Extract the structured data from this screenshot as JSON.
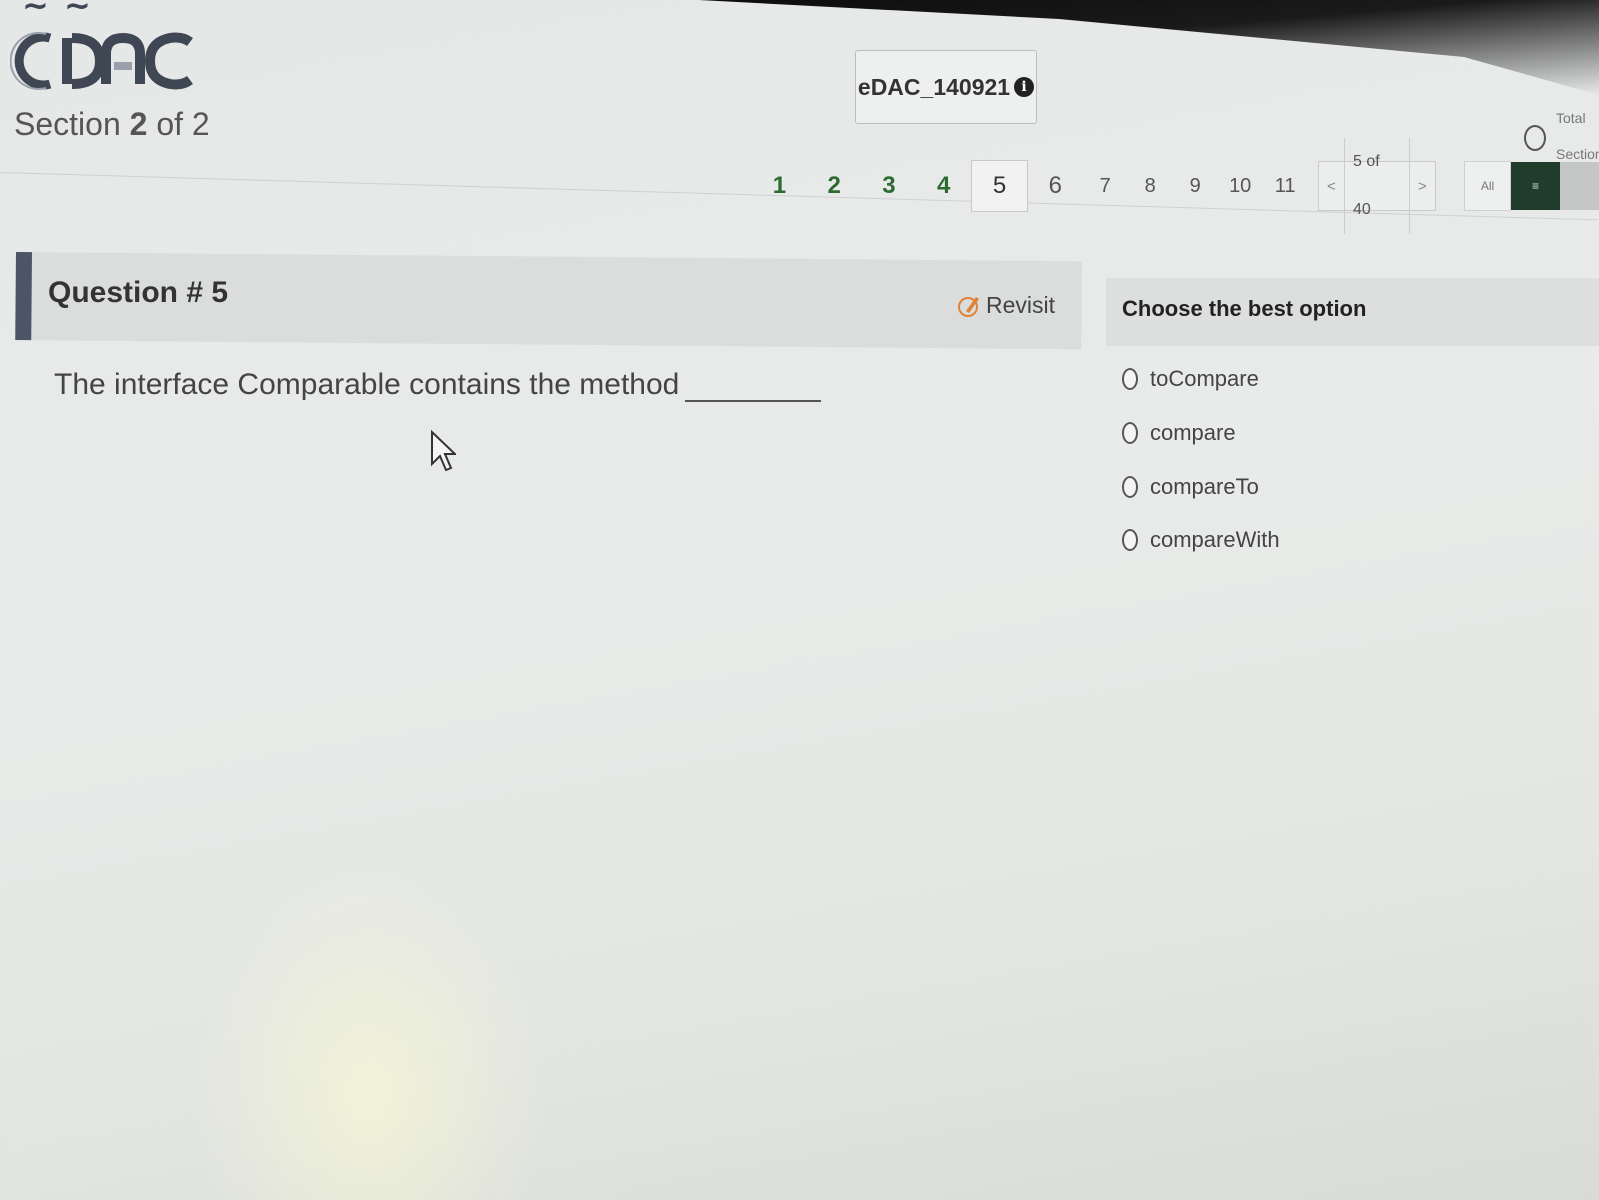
{
  "header": {
    "logo_text": "CDAC",
    "section_label": "Section",
    "section_current": "2",
    "section_of": "of 2",
    "candidate_id": "eDAC_140921",
    "info_icon": "info-icon",
    "timer_line1": "Total",
    "timer_line2": "Section"
  },
  "pager": {
    "questions": [
      "1",
      "2",
      "3",
      "4",
      "5",
      "6",
      "7",
      "8",
      "9",
      "10",
      "11"
    ],
    "answered": [
      "1",
      "2",
      "3",
      "4"
    ],
    "current": "5",
    "position_text": "5 of 40",
    "prev": "<",
    "next": ">",
    "all_label": "All",
    "view_label": "≡"
  },
  "question": {
    "title": "Question # 5",
    "revisit_label": "Revisit",
    "text": "The interface Comparable contains the method"
  },
  "options": {
    "title": "Choose the best option",
    "items": [
      "toCompare",
      "compare",
      "compareTo",
      "compareWith"
    ]
  },
  "colors": {
    "accent_bar": "#4c5566",
    "answered": "#2e6b33",
    "grid_button": "#1f3d2a"
  }
}
